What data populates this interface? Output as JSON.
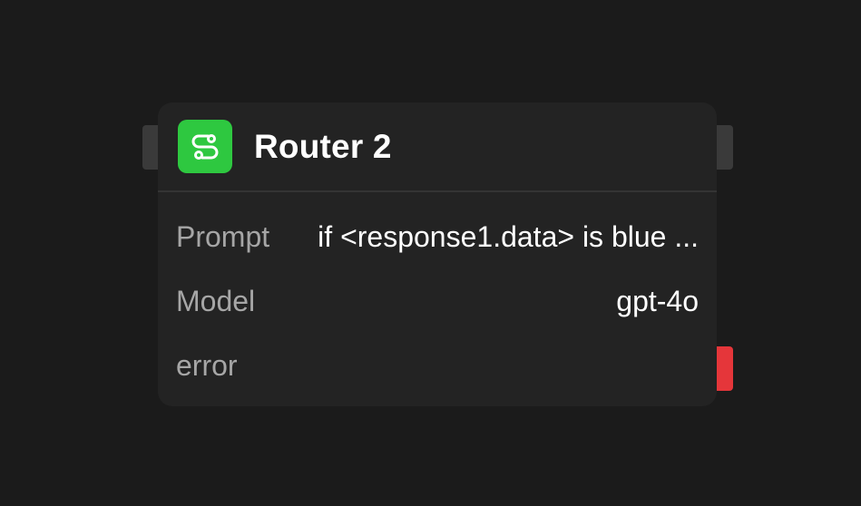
{
  "node": {
    "title": "Router 2",
    "icon": "router-icon",
    "icon_color": "#2ec840",
    "rows": {
      "prompt": {
        "label": "Prompt",
        "value": "if <response1.data> is blue ..."
      },
      "model": {
        "label": "Model",
        "value": "gpt-4o"
      },
      "error": {
        "label": "error"
      }
    }
  },
  "colors": {
    "background": "#1b1b1b",
    "node_background": "#232323",
    "error_handle": "#e5363a",
    "handle": "#3a3a3a"
  }
}
